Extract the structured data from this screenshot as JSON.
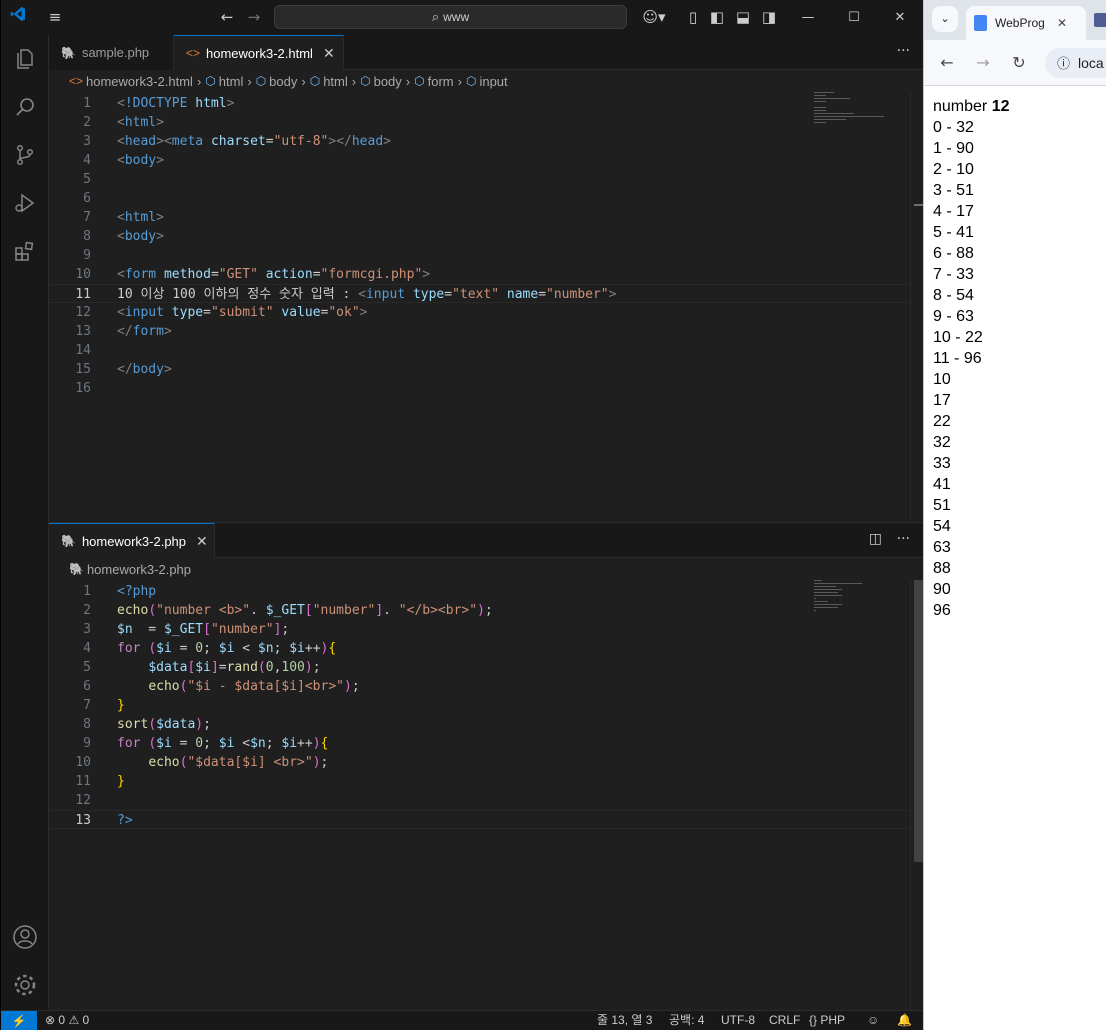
{
  "vscode": {
    "search_text": "www",
    "tabs_top": [
      {
        "label": "sample.php",
        "active": false
      },
      {
        "label": "homework3-2.html",
        "active": true
      }
    ],
    "breadcrumb_top": [
      "homework3-2.html",
      "html",
      "body",
      "html",
      "body",
      "form",
      "input"
    ],
    "html_lines": [
      "<!DOCTYPE html>",
      "<html>",
      "<head><meta charset=\"utf-8\"></head>",
      "<body>",
      "",
      "",
      "<html>",
      "<body>",
      "",
      "<form method=\"GET\" action=\"formcgi.php\">",
      "10 이상 100 이하의 정수 숫자 입력 : <input type=\"text\" name=\"number\">",
      "<input type=\"submit\" value=\"ok\">",
      "</form>",
      "",
      "</body>",
      ""
    ],
    "tab_bottom": "homework3-2.php",
    "breadcrumb_bottom": "homework3-2.php",
    "php_lines": [
      "<?php",
      "echo(\"number <b>\". $_GET[\"number\"]. \"</b><br>\");",
      "$n  = $_GET[\"number\"];",
      "for ($i = 0; $i < $n; $i++){",
      "    $data[$i]=rand(0,100);",
      "    echo(\"$i - $data[$i]<br>\");",
      "}",
      "sort($data);",
      "for ($i = 0; $i <$n; $i++){",
      "    echo(\"$data[$i] <br>\");",
      "}",
      "",
      "?>"
    ],
    "status": {
      "errors": "0",
      "warnings": "0",
      "position": "줄 13, 열 3",
      "spaces": "공백: 4",
      "encoding": "UTF-8",
      "eol": "CRLF",
      "language": "PHP"
    },
    "accent_color": "#0078d4"
  },
  "browser": {
    "tab_title": "WebProg",
    "address": "loca",
    "heading_label": "number",
    "heading_value": "12",
    "pairs": [
      "0 - 32",
      "1 - 90",
      "2 - 10",
      "3 - 51",
      "4 - 17",
      "5 - 41",
      "6 - 88",
      "7 - 33",
      "8 - 54",
      "9 - 63",
      "10 - 22",
      "11 - 96"
    ],
    "sorted": [
      "10",
      "17",
      "22",
      "32",
      "33",
      "41",
      "51",
      "54",
      "63",
      "88",
      "90",
      "96"
    ]
  }
}
